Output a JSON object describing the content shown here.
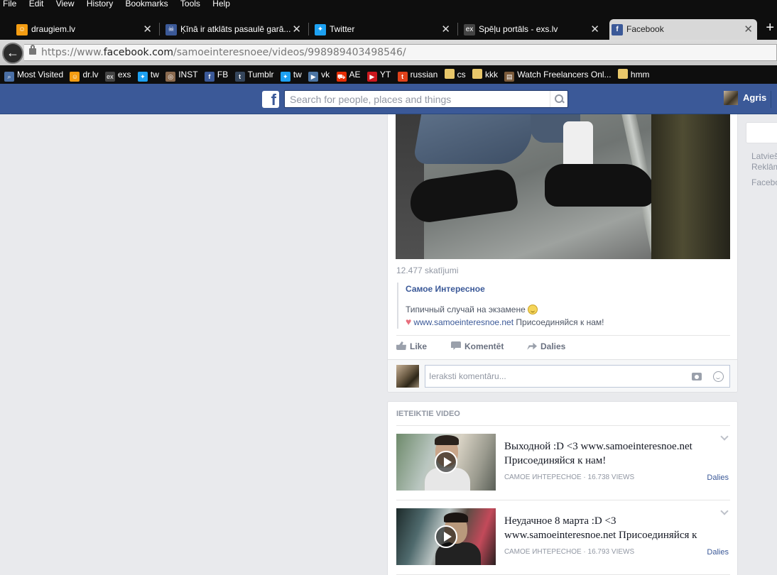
{
  "browser": {
    "menu": [
      "File",
      "Edit",
      "View",
      "History",
      "Bookmarks",
      "Tools",
      "Help"
    ],
    "tabs": [
      {
        "label": "draugiem.lv",
        "icon": "draugiem-icon"
      },
      {
        "label": "Ķīnā ir atklāts pasaulē garā...",
        "icon": "skull-icon"
      },
      {
        "label": "Twitter",
        "icon": "twitter-bird-icon"
      },
      {
        "label": "Spēļu portāls - exs.lv",
        "icon": "exs-icon"
      },
      {
        "label": "Facebook",
        "icon": "facebook-icon"
      }
    ],
    "url": {
      "scheme": "https://www.",
      "host": "facebook.com",
      "path": "/samoeinteresnoee/videos/998989403498546/"
    },
    "bookmarks": [
      {
        "label": "Most Visited",
        "icon": "search-icon"
      },
      {
        "label": "dr.lv",
        "icon": "draugiem-icon"
      },
      {
        "label": "exs",
        "icon": "exs-icon"
      },
      {
        "label": "tw",
        "icon": "twitter-bird-icon"
      },
      {
        "label": "INST",
        "icon": "instagram-icon"
      },
      {
        "label": "FB",
        "icon": "facebook-icon"
      },
      {
        "label": "Tumblr",
        "icon": "tumblr-icon"
      },
      {
        "label": "tw",
        "icon": "twitter-bird-icon"
      },
      {
        "label": "vk",
        "icon": "vk-icon"
      },
      {
        "label": "AE",
        "icon": "cart-icon"
      },
      {
        "label": "YT",
        "icon": "youtube-icon"
      },
      {
        "label": "russian",
        "icon": "t-icon"
      },
      {
        "label": "cs",
        "icon": "folder-icon"
      },
      {
        "label": "kkk",
        "icon": "folder-icon"
      },
      {
        "label": "Watch Freelancers Onl...",
        "icon": "film-icon"
      },
      {
        "label": "hmm",
        "icon": "folder-icon"
      }
    ]
  },
  "header": {
    "logo": "f",
    "search_placeholder": "Search for people, places and things",
    "username": "Agris"
  },
  "post": {
    "views": "12.477 skatījumi",
    "page_name": "Самое Интересное",
    "text": "Типичный случай на экзамене",
    "link": "www.samoeinteresnoe.net",
    "link_suffix": " Присоединяйся к нам!",
    "actions": {
      "like": "Like",
      "comment": "Komentēt",
      "share": "Dalies"
    },
    "comment_placeholder": "Ieraksti komentāru..."
  },
  "suggested": {
    "title": "IETEIKTIE VIDEO",
    "items": [
      {
        "title": "Выходной :D <3 www.samoeinteresnoe.net Присоединяйся к нам!",
        "meta": "САМОЕ ИНТЕРЕСНОЕ · 16.738 VIEWS",
        "share": "Dalies"
      },
      {
        "title": "Неудачное 8 марта :D <3 www.samoeinteresnoe.net Присоединяйся к",
        "meta": "САМОЕ ИНТЕРЕСНОЕ · 16.793 VIEWS",
        "share": "Dalies"
      }
    ]
  },
  "right_column": {
    "line1": "Latvieš",
    "line2": "Reklām",
    "line3": "Facebo"
  }
}
